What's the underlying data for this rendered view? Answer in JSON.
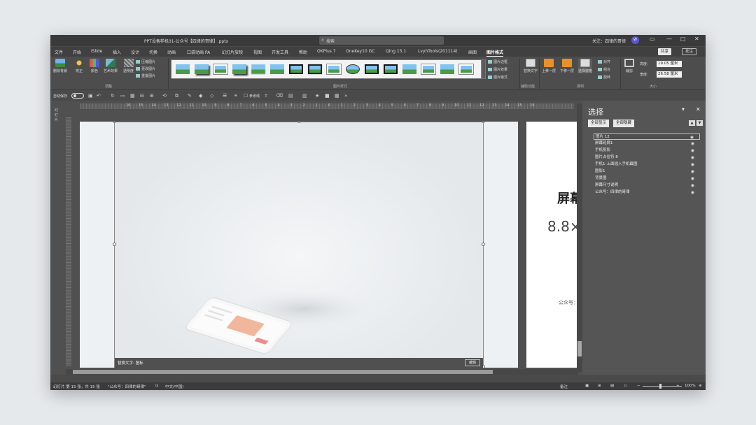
{
  "titlebar": {
    "document": "PPT设备样机01-公众号【四律的哥律】.pptx",
    "search": "搜索",
    "follow": "关注：四律的哥律",
    "avatar": "W"
  },
  "tabs": [
    "文件",
    "开始",
    "iSlide",
    "插入",
    "设计",
    "切换",
    "动画",
    "口袋动画 PA",
    "幻灯片放映",
    "视图",
    "开发工具",
    "帮助",
    "OKPlus 7",
    "OneKey10 GC",
    "Qing 15.1",
    "LvyhTools(201114)",
    "画图",
    "图片格式"
  ],
  "share": "共享",
  "notes_btn": "批注",
  "ribbon": {
    "remove_bg": "删除背景",
    "correct": "校正",
    "color": "颜色",
    "art": "艺术效果",
    "transparency": "透明度",
    "compress": "压缩图片",
    "change": "更改图片",
    "reset": "重置图片",
    "adjust_group": "调整",
    "styles_group": "图片样式",
    "border": "图片边框",
    "effects": "图片效果",
    "layout": "图片版式",
    "alt_text": "替换文字",
    "access_group": "辅助功能",
    "bring_fwd": "上移一层",
    "send_back": "下移一层",
    "sel_pane": "选择窗格",
    "align": "对齐",
    "group": "组合",
    "rotate": "旋转",
    "arrange_group": "排列",
    "crop": "裁剪",
    "height_label": "高度:",
    "height": "19.05 厘米",
    "width_label": "宽度:",
    "width": "26.58 厘米",
    "size_group": "大小"
  },
  "qat": {
    "autosave": "自动保存",
    "ref_line": "参考线"
  },
  "ruler_numbers": [
    "16",
    "15",
    "14",
    "13",
    "12",
    "11",
    "10",
    "9",
    "8",
    "7",
    "6",
    "5",
    "4",
    "3",
    "2",
    "1",
    "0",
    "1",
    "2",
    "3",
    "4",
    "5",
    "6",
    "7",
    "8",
    "9",
    "10",
    "11",
    "12",
    "13",
    "14",
    "15",
    "16"
  ],
  "slide": {
    "alt_text": "替换文字: 图标",
    "edit": "编辑"
  },
  "next_slide": {
    "title": "屏幕",
    "size": "8.8×",
    "footer": "公众号："
  },
  "side_tab": "幻灯片",
  "pane": {
    "title": "选择",
    "show_all": "全部显示",
    "hide_all": "全部隐藏",
    "items": [
      "图片 12",
      "屏幕轮廓1",
      "手机剪影",
      "图片占位符 8",
      "手机1-上面插入手机截图",
      "图影1",
      "背景图",
      "屏幕尺寸说明",
      "公众号：四律的哥律"
    ]
  },
  "status": {
    "slide": "幻灯片 第 15 张，共 15 张",
    "theme": "\"公众号：四律的哥律\"",
    "lang": "中文(中国)",
    "notes": "备注",
    "zoom": "100%"
  }
}
